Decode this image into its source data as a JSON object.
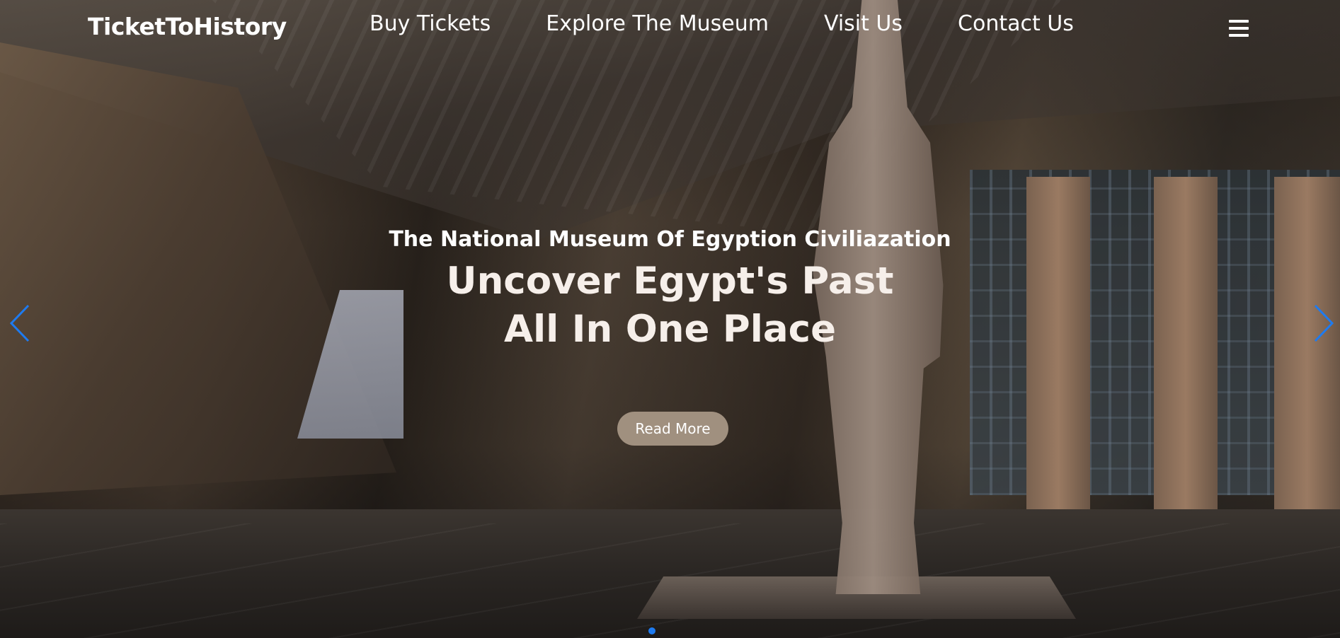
{
  "navbar": {
    "brand": "TicketToHistory",
    "links": [
      {
        "label": "Buy Tickets"
      },
      {
        "label": "Explore The Museum"
      },
      {
        "label": "Visit Us"
      },
      {
        "label": "Contact Us"
      }
    ],
    "menu_icon": "hamburger-menu-icon"
  },
  "hero": {
    "subtitle": "The National Museum Of Egyption Civiliazation",
    "headline_line1": "Uncover Egypt's Past",
    "headline_line2": "All In One Place",
    "cta_label": "Read More"
  },
  "carousel": {
    "prev_icon": "chevron-left-icon",
    "next_icon": "chevron-right-icon",
    "indicator_count": 1,
    "active_index": 0
  },
  "colors": {
    "arrow": "#1e7bf0",
    "indicator": "#1e7bf0",
    "cta_background": "#a0907f",
    "text": "#ffffff"
  }
}
